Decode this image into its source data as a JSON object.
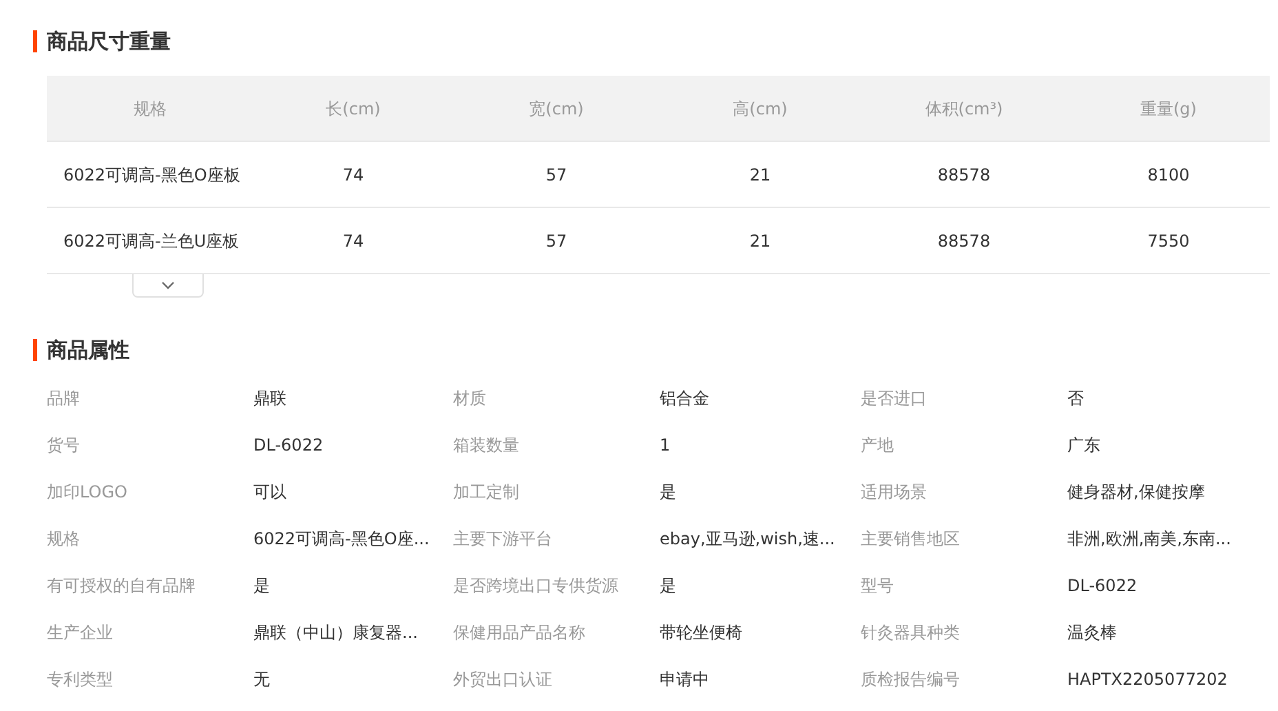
{
  "size_section": {
    "title": "商品尺寸重量",
    "columns": [
      "规格",
      "长(cm)",
      "宽(cm)",
      "高(cm)",
      "体积(cm³)",
      "重量(g)"
    ],
    "rows": [
      [
        "6022可调高-黑色O座板",
        "74",
        "57",
        "21",
        "88578",
        "8100"
      ],
      [
        "6022可调高-兰色U座板",
        "74",
        "57",
        "21",
        "88578",
        "7550"
      ]
    ],
    "expanded": false
  },
  "attributes_section": {
    "title": "商品属性",
    "attributes": [
      {
        "label": "品牌",
        "value": "鼎联"
      },
      {
        "label": "材质",
        "value": "铝合金"
      },
      {
        "label": "是否进口",
        "value": "否"
      },
      {
        "label": "货号",
        "value": "DL-6022"
      },
      {
        "label": "箱装数量",
        "value": "1"
      },
      {
        "label": "产地",
        "value": "广东"
      },
      {
        "label": "加印LOGO",
        "value": "可以"
      },
      {
        "label": "加工定制",
        "value": "是"
      },
      {
        "label": "适用场景",
        "value": "健身器材,保健按摩"
      },
      {
        "label": "规格",
        "value": "6022可调高-黑色O座..."
      },
      {
        "label": "主要下游平台",
        "value": "ebay,亚马逊,wish,速..."
      },
      {
        "label": "主要销售地区",
        "value": "非洲,欧洲,南美,东南..."
      },
      {
        "label": "有可授权的自有品牌",
        "value": "是"
      },
      {
        "label": "是否跨境出口专供货源",
        "value": "是"
      },
      {
        "label": "型号",
        "value": "DL-6022"
      },
      {
        "label": "生产企业",
        "value": "鼎联（中山）康复器..."
      },
      {
        "label": "保健用品产品名称",
        "value": "带轮坐便椅"
      },
      {
        "label": "针灸器具种类",
        "value": "温灸棒"
      },
      {
        "label": "专利类型",
        "value": "无"
      },
      {
        "label": "外贸出口认证",
        "value": "申请中"
      },
      {
        "label": "质检报告编号",
        "value": "HAPTX2205077202"
      }
    ]
  }
}
